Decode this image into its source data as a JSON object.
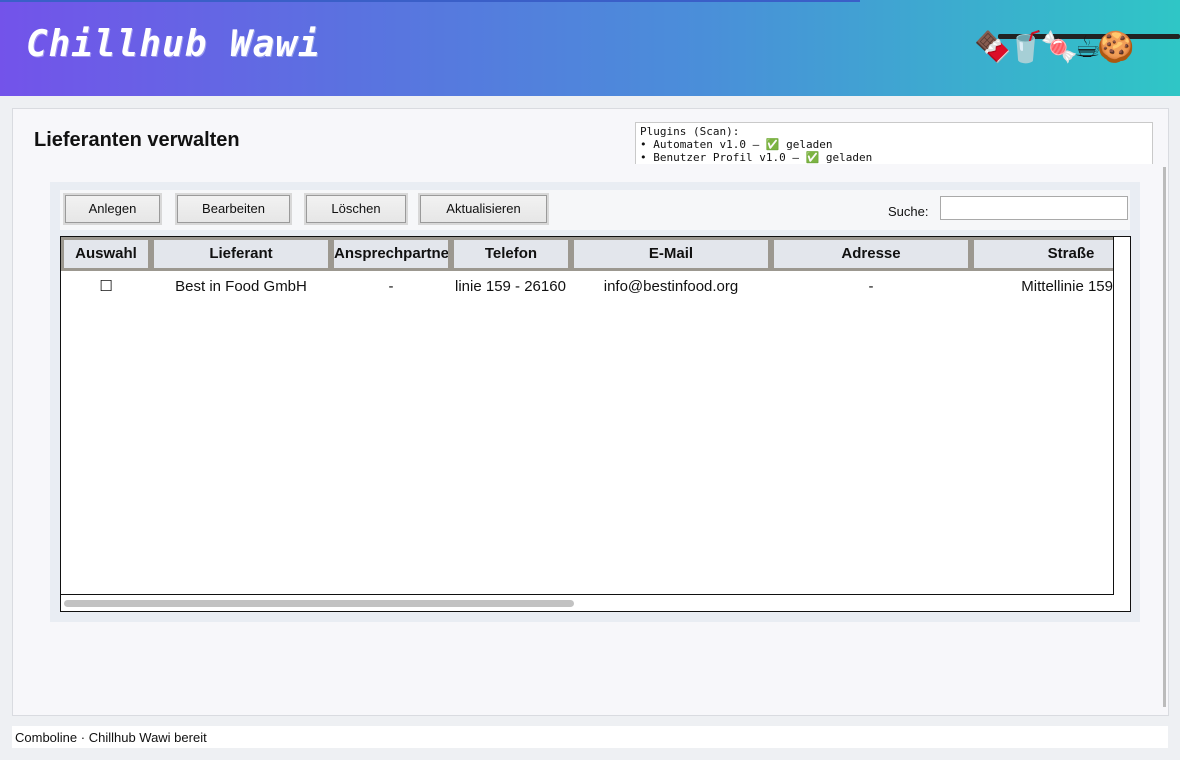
{
  "app": {
    "title": "Chillhub Wawi",
    "snacks": "🍫🥤🍬☕🍪"
  },
  "page": {
    "title": "Lieferanten verwalten"
  },
  "plugins": {
    "text": "Plugins (Scan):\n• Automaten v1.0 – ✅ geladen\n• Benutzer Profil v1.0 – ✅ geladen"
  },
  "toolbar": {
    "create_label": "Anlegen",
    "edit_label": "Bearbeiten",
    "delete_label": "Löschen",
    "refresh_label": "Aktualisieren",
    "search_label": "Suche:",
    "search_value": ""
  },
  "table": {
    "columns": [
      "Auswahl",
      "Lieferant",
      "Ansprechpartner",
      "Telefon",
      "E-Mail",
      "Adresse",
      "Straße"
    ],
    "rows": [
      [
        "☐",
        "Best in Food GmbH",
        "-",
        "linie 159 - 26160",
        "info@bestinfood.org",
        "-",
        "Mittellinie 159"
      ]
    ]
  },
  "status": {
    "text": "Comboline · Chillhub Wawi bereit"
  },
  "colors": {
    "header_start": "#7353ea",
    "header_end": "#2fc6c6",
    "table_header_bg": "#e3e6ec"
  }
}
